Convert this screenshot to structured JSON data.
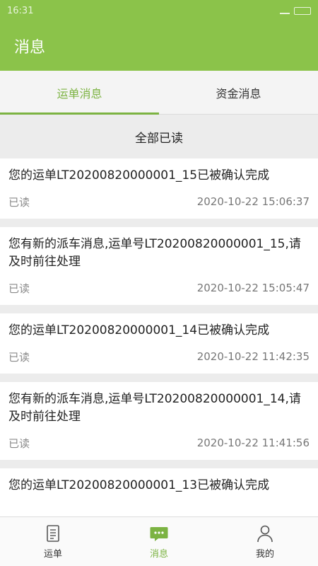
{
  "status_bar": {
    "time": "16:31"
  },
  "header": {
    "title": "消息"
  },
  "tabs": [
    {
      "label": "运单消息",
      "active": true
    },
    {
      "label": "资金消息",
      "active": false
    }
  ],
  "read_all_label": "全部已读",
  "messages": [
    {
      "text": "您的运单LT20200820000001_15已被确认完成",
      "status": "已读",
      "time": "2020-10-22 15:06:37"
    },
    {
      "text": "您有新的派车消息,运单号LT20200820000001_15,请及时前往处理",
      "status": "已读",
      "time": "2020-10-22 15:05:47"
    },
    {
      "text": "您的运单LT20200820000001_14已被确认完成",
      "status": "已读",
      "time": "2020-10-22 11:42:35"
    },
    {
      "text": "您有新的派车消息,运单号LT20200820000001_14,请及时前往处理",
      "status": "已读",
      "time": "2020-10-22 11:41:56"
    },
    {
      "text": "您的运单LT20200820000001_13已被确认完成",
      "status": "",
      "time": ""
    }
  ],
  "bottom_nav": [
    {
      "label": "运单",
      "icon": "document-icon",
      "active": false
    },
    {
      "label": "消息",
      "icon": "chat-icon",
      "active": true
    },
    {
      "label": "我的",
      "icon": "user-icon",
      "active": false
    }
  ],
  "colors": {
    "primary": "#8bc34a",
    "accent": "#7cb342",
    "background": "#ececec"
  }
}
